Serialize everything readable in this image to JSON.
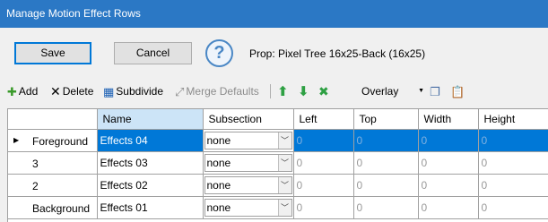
{
  "window": {
    "title": "Manage Motion Effect Rows"
  },
  "buttons": {
    "save": "Save",
    "cancel": "Cancel",
    "help": "?"
  },
  "prop_label": "Prop: Pixel Tree 16x25-Back (16x25)",
  "toolbar": {
    "add": "Add",
    "delete": "Delete",
    "subdivide": "Subdivide",
    "merge_defaults": "Merge Defaults",
    "blend_mode": "Overlay",
    "icons": {
      "add": "plus-icon",
      "delete": "x-icon",
      "subdivide": "grid-icon",
      "merge": "merge-icon",
      "up": "arrow-up-icon",
      "down": "arrow-down-icon",
      "shuffle": "shuffle-icon",
      "copy": "copy-icon",
      "paste": "paste-icon"
    }
  },
  "grid": {
    "columns": [
      "Name",
      "Subsection",
      "Left",
      "Top",
      "Width",
      "Height"
    ],
    "rows": [
      {
        "label": "Foreground",
        "name": "Effects 04",
        "subsection": "none",
        "left": "0",
        "top": "0",
        "width": "0",
        "height": "0",
        "selected": true
      },
      {
        "label": "3",
        "name": "Effects 03",
        "subsection": "none",
        "left": "0",
        "top": "0",
        "width": "0",
        "height": "0",
        "selected": false
      },
      {
        "label": "2",
        "name": "Effects 02",
        "subsection": "none",
        "left": "0",
        "top": "0",
        "width": "0",
        "height": "0",
        "selected": false
      },
      {
        "label": "Background",
        "name": "Effects 01",
        "subsection": "none",
        "left": "0",
        "top": "0",
        "width": "0",
        "height": "0",
        "selected": false
      }
    ]
  },
  "colors": {
    "titlebar": "#2b78c5",
    "selection": "#0078d7",
    "up_arrow": "#2ea043",
    "down_arrow": "#2ea043"
  }
}
